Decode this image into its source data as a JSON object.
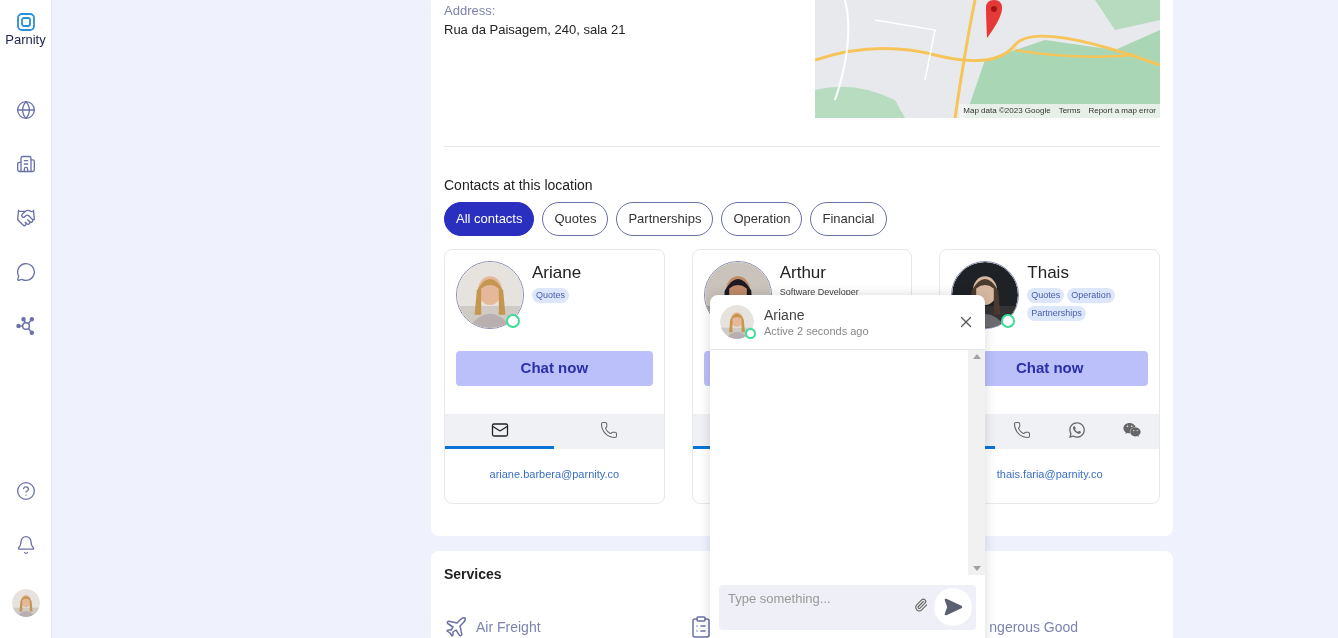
{
  "sidebar": {
    "logo": "Parnity",
    "nav": [
      {
        "kind": "globe"
      },
      {
        "kind": "building"
      },
      {
        "kind": "handshake"
      },
      {
        "kind": "chat"
      },
      {
        "kind": "network"
      }
    ],
    "bottom": [
      {
        "kind": "help"
      },
      {
        "kind": "bell"
      },
      {
        "kind": "avatar"
      }
    ]
  },
  "location": {
    "address_label": "Address:",
    "address": "Rua da Paisagem, 240, sala 21",
    "map": {
      "kind": "picture",
      "attribution": [
        "Map data ©2023 Google",
        "Terms",
        "Report a map error"
      ]
    }
  },
  "contacts": {
    "title": "Contacts at this location",
    "filters": [
      {
        "label": "All contacts",
        "selected": true
      },
      {
        "label": "Quotes",
        "selected": false
      },
      {
        "label": "Partnerships",
        "selected": false
      },
      {
        "label": "Operation",
        "selected": false
      },
      {
        "label": "Financial",
        "selected": false
      }
    ],
    "people": [
      {
        "name": "Ariane",
        "online": true,
        "tags": [
          "Quotes"
        ],
        "chat_button": "Chat now",
        "methods": [
          {
            "kind": "email",
            "selected": true
          },
          {
            "kind": "phone",
            "selected": false
          }
        ],
        "email": "ariane.barbera@parnity.co"
      },
      {
        "name": "Arthur",
        "subtitle": "Software Developer",
        "methods": [
          {
            "selected": true
          }
        ]
      },
      {
        "name": "Thais",
        "online": true,
        "tags": [
          "Quotes",
          "Operation",
          "Partnerships"
        ],
        "chat_button": "Chat now",
        "methods": [
          {
            "selected": true
          },
          {
            "kind": "phone",
            "selected": false
          },
          {
            "kind": "whatsapp",
            "selected": false
          },
          {
            "kind": "wechat",
            "selected": false
          }
        ],
        "email": "thais.faria@parnity.co"
      }
    ]
  },
  "services": {
    "title": "Services",
    "items": [
      {
        "kind": "plane",
        "label": "Air Freight"
      },
      {
        "kind": "clipboard"
      },
      {
        "kind": "hidden",
        "label": "ngerous Good"
      }
    ]
  },
  "chat": {
    "name": "Ariane",
    "online": true,
    "status": "Active 2 seconds ago",
    "placeholder": "Type something..."
  }
}
